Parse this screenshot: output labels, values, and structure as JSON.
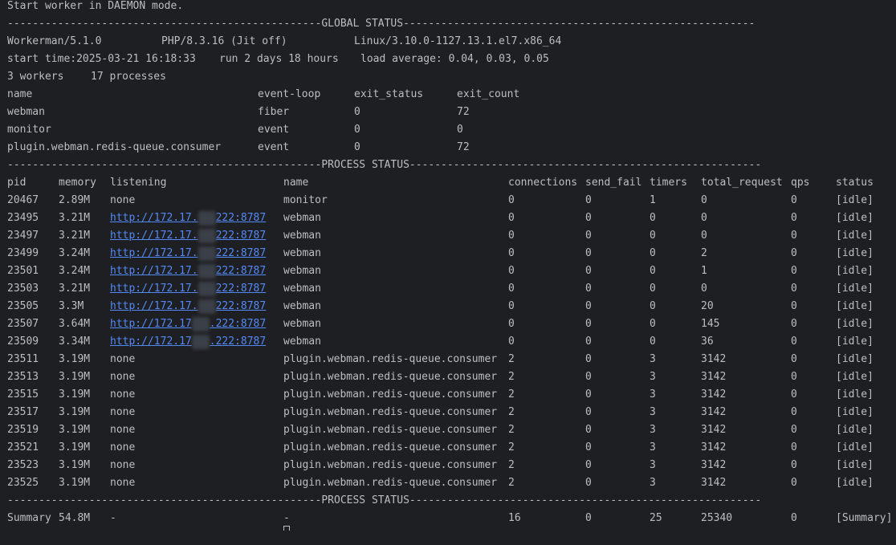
{
  "header": {
    "line": "Start worker in DAEMON mode."
  },
  "global": {
    "sep_label": "GLOBAL STATUS",
    "workerman": "Workerman/5.1.0",
    "php": "PHP/8.3.16 (Jit off)",
    "os": "Linux/3.10.0-1127.13.1.el7.x86_64",
    "start_time": "start time:2025-03-21 16:18:33",
    "run": "run 2 days 18 hours",
    "load": "load average: 0.04, 0.03, 0.05",
    "workers": "3 workers",
    "processes": "17 processes"
  },
  "worker_table": {
    "headers": [
      "name",
      "event-loop",
      "exit_status",
      "exit_count"
    ],
    "rows": [
      [
        "webman",
        "fiber",
        "0",
        "72"
      ],
      [
        "monitor",
        "event",
        "0",
        "0"
      ],
      [
        "plugin.webman.redis-queue.consumer",
        "event",
        "0",
        "72"
      ]
    ]
  },
  "process": {
    "sep_label": "PROCESS STATUS",
    "headers": [
      "pid",
      "memory",
      "listening",
      "name",
      "connections",
      "send_fail",
      "timers",
      "total_request",
      "qps",
      "status"
    ],
    "rows": [
      {
        "pid": "20467",
        "memory": "2.89M",
        "listen_plain": "none",
        "name": "monitor",
        "connections": "0",
        "send_fail": "0",
        "timers": "1",
        "total_request": "0",
        "qps": "0",
        "status": "[idle]"
      },
      {
        "pid": "23495",
        "memory": "3.21M",
        "listen_a": "http://172.17.",
        "listen_b": "222:8787",
        "name": "webman",
        "connections": "0",
        "send_fail": "0",
        "timers": "0",
        "total_request": "0",
        "qps": "0",
        "status": "[idle]"
      },
      {
        "pid": "23497",
        "memory": "3.21M",
        "listen_a": "http://172.17.",
        "listen_b": "222:8787",
        "name": "webman",
        "connections": "0",
        "send_fail": "0",
        "timers": "0",
        "total_request": "0",
        "qps": "0",
        "status": "[idle]"
      },
      {
        "pid": "23499",
        "memory": "3.24M",
        "listen_a": "http://172.17.",
        "listen_b": "222:8787",
        "name": "webman",
        "connections": "0",
        "send_fail": "0",
        "timers": "0",
        "total_request": "2",
        "qps": "0",
        "status": "[idle]"
      },
      {
        "pid": "23501",
        "memory": "3.24M",
        "listen_a": "http://172.17.",
        "listen_b": "222:8787",
        "name": "webman",
        "connections": "0",
        "send_fail": "0",
        "timers": "0",
        "total_request": "1",
        "qps": "0",
        "status": "[idle]"
      },
      {
        "pid": "23503",
        "memory": "3.21M",
        "listen_a": "http://172.17.",
        "listen_b": "222:8787",
        "name": "webman",
        "connections": "0",
        "send_fail": "0",
        "timers": "0",
        "total_request": "0",
        "qps": "0",
        "status": "[idle]"
      },
      {
        "pid": "23505",
        "memory": "3.3M",
        "listen_a": "http://172.17.",
        "listen_b": "222:8787",
        "name": "webman",
        "connections": "0",
        "send_fail": "0",
        "timers": "0",
        "total_request": "20",
        "qps": "0",
        "status": "[idle]"
      },
      {
        "pid": "23507",
        "memory": "3.64M",
        "listen_a": "http://172.17",
        "listen_b": ".222:8787",
        "name": "webman",
        "connections": "0",
        "send_fail": "0",
        "timers": "0",
        "total_request": "145",
        "qps": "0",
        "status": "[idle]"
      },
      {
        "pid": "23509",
        "memory": "3.34M",
        "listen_a": "http://172.17",
        "listen_b": ".222:8787",
        "name": "webman",
        "connections": "0",
        "send_fail": "0",
        "timers": "0",
        "total_request": "36",
        "qps": "0",
        "status": "[idle]"
      },
      {
        "pid": "23511",
        "memory": "3.19M",
        "listen_plain": "none",
        "name": "plugin.webman.redis-queue.consumer",
        "connections": "2",
        "send_fail": "0",
        "timers": "3",
        "total_request": "3142",
        "qps": "0",
        "status": "[idle]"
      },
      {
        "pid": "23513",
        "memory": "3.19M",
        "listen_plain": "none",
        "name": "plugin.webman.redis-queue.consumer",
        "connections": "2",
        "send_fail": "0",
        "timers": "3",
        "total_request": "3142",
        "qps": "0",
        "status": "[idle]"
      },
      {
        "pid": "23515",
        "memory": "3.19M",
        "listen_plain": "none",
        "name": "plugin.webman.redis-queue.consumer",
        "connections": "2",
        "send_fail": "0",
        "timers": "3",
        "total_request": "3142",
        "qps": "0",
        "status": "[idle]"
      },
      {
        "pid": "23517",
        "memory": "3.19M",
        "listen_plain": "none",
        "name": "plugin.webman.redis-queue.consumer",
        "connections": "2",
        "send_fail": "0",
        "timers": "3",
        "total_request": "3142",
        "qps": "0",
        "status": "[idle]"
      },
      {
        "pid": "23519",
        "memory": "3.19M",
        "listen_plain": "none",
        "name": "plugin.webman.redis-queue.consumer",
        "connections": "2",
        "send_fail": "0",
        "timers": "3",
        "total_request": "3142",
        "qps": "0",
        "status": "[idle]"
      },
      {
        "pid": "23521",
        "memory": "3.19M",
        "listen_plain": "none",
        "name": "plugin.webman.redis-queue.consumer",
        "connections": "2",
        "send_fail": "0",
        "timers": "3",
        "total_request": "3142",
        "qps": "0",
        "status": "[idle]"
      },
      {
        "pid": "23523",
        "memory": "3.19M",
        "listen_plain": "none",
        "name": "plugin.webman.redis-queue.consumer",
        "connections": "2",
        "send_fail": "0",
        "timers": "3",
        "total_request": "3142",
        "qps": "0",
        "status": "[idle]"
      },
      {
        "pid": "23525",
        "memory": "3.19M",
        "listen_plain": "none",
        "name": "plugin.webman.redis-queue.consumer",
        "connections": "2",
        "send_fail": "0",
        "timers": "3",
        "total_request": "3142",
        "qps": "0",
        "status": "[idle]"
      }
    ],
    "summary": {
      "pid": "Summary",
      "memory": "54.8M",
      "listen_plain": "-",
      "name": "-",
      "connections": "16",
      "send_fail": "0",
      "timers": "25",
      "total_request": "25340",
      "qps": "0",
      "status": "[Summary]"
    }
  },
  "colors": {
    "background": "#1e1f22",
    "text": "#bcbec4",
    "link": "#548af7"
  }
}
